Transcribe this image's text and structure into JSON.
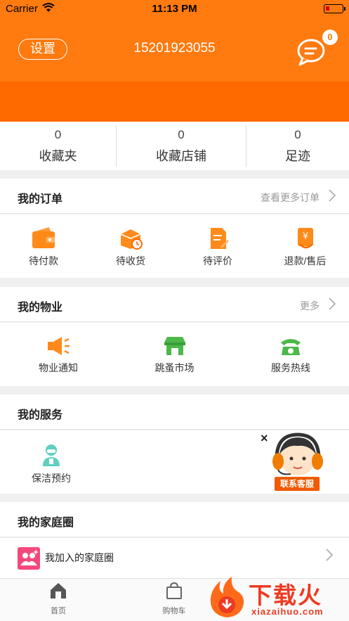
{
  "status_bar": {
    "carrier": "Carrier",
    "time": "11:13 PM",
    "battery_level": 0.25
  },
  "header": {
    "settings_label": "设置",
    "phone": "15201923055",
    "message_count": "0"
  },
  "stats": [
    {
      "value": "0",
      "label": "收藏夹"
    },
    {
      "value": "0",
      "label": "收藏店铺"
    },
    {
      "value": "0",
      "label": "足迹"
    }
  ],
  "orders": {
    "title": "我的订单",
    "more": "查看更多订单",
    "items": [
      {
        "label": "待付款",
        "icon": "wallet-icon"
      },
      {
        "label": "待收货",
        "icon": "package-clock-icon"
      },
      {
        "label": "待评价",
        "icon": "edit-doc-icon"
      },
      {
        "label": "退款/售后",
        "icon": "refund-icon"
      }
    ]
  },
  "property": {
    "title": "我的物业",
    "more": "更多",
    "items": [
      {
        "label": "物业通知",
        "icon": "megaphone-icon"
      },
      {
        "label": "跳蚤市场",
        "icon": "market-stall-icon"
      },
      {
        "label": "服务热线",
        "icon": "telephone-icon"
      }
    ]
  },
  "services": {
    "title": "我的服务",
    "items": [
      {
        "label": "保洁预约",
        "icon": "cleaner-icon"
      }
    ]
  },
  "customer_service": {
    "label": "联系客服",
    "close": "×"
  },
  "family": {
    "title": "我的家庭圈",
    "row_label": "我加入的家庭圈"
  },
  "tabbar": [
    {
      "label": "首页",
      "icon": "home-icon"
    },
    {
      "label": "购物车",
      "icon": "shopping-bag-icon"
    }
  ],
  "watermark": {
    "big": "下载火",
    "small": "xiazaihuo.com"
  },
  "colors": {
    "accent": "#ff7a0f",
    "service_green": "#4cb848",
    "notice_orange": "#ff8a1a"
  }
}
